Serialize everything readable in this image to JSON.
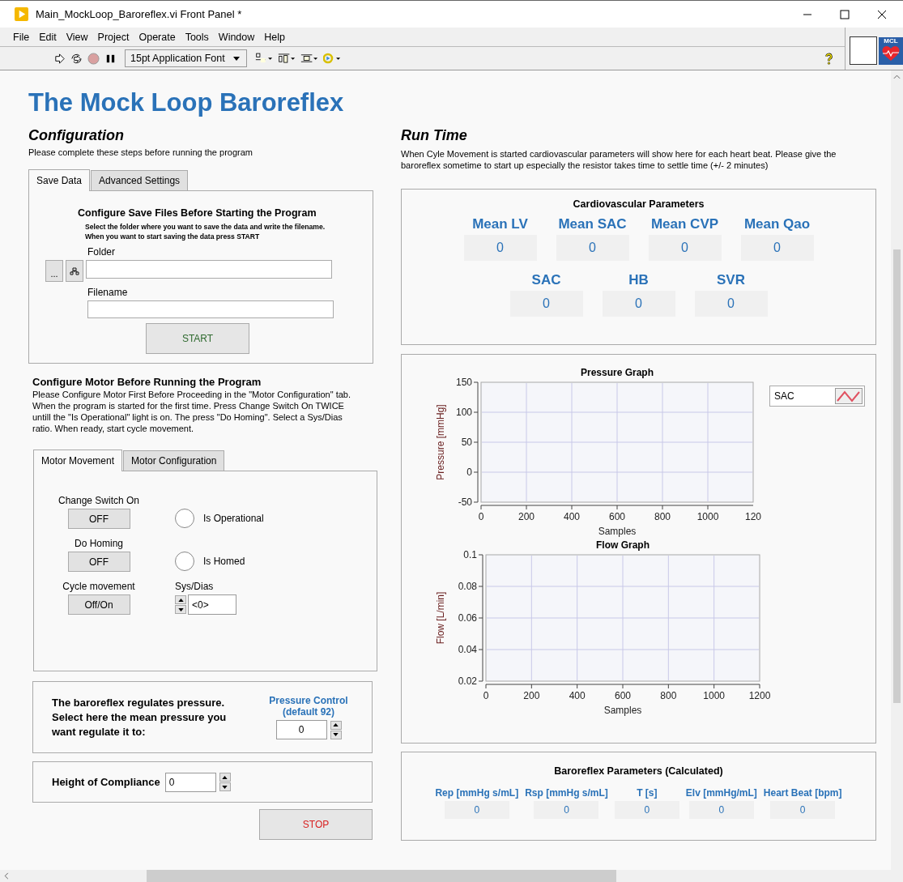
{
  "window": {
    "title": "Main_MockLoop_Baroreflex.vi Front Panel *"
  },
  "menu": [
    "File",
    "Edit",
    "View",
    "Project",
    "Operate",
    "Tools",
    "Window",
    "Help"
  ],
  "toolbar": {
    "font_select": "15pt Application Font",
    "logo_text": "MCL"
  },
  "page_title": "The Mock Loop Baroreflex",
  "configuration": {
    "heading": "Configuration",
    "subtitle": "Please complete these steps before running the program",
    "tabs": [
      {
        "label": "Save Data",
        "selected": true
      },
      {
        "label": "Advanced Settings",
        "selected": false
      }
    ],
    "save_panel": {
      "heading": "Configure Save Files Before Starting the Program",
      "instructions": "Select the folder where you want to save the data and write the filename. When you want to start saving the data press START",
      "browse_button": "...",
      "folder_label": "Folder",
      "filename_label": "Filename",
      "start_button": "START"
    },
    "motor": {
      "heading": "Configure Motor Before Running the Program",
      "instructions": "Please Configure Motor First Before Proceeding in the \"Motor Configuration\" tab. When the program is started for the first time. Press Change Switch On TWICE untill the \"Is Operational\" light is on. The press \"Do Homing\". Select a Sys/Dias ratio. When ready, start cycle movement.",
      "tabs": [
        {
          "label": "Motor Movement",
          "selected": true
        },
        {
          "label": "Motor Configuration",
          "selected": false
        }
      ],
      "controls": [
        {
          "label": "Change Switch On",
          "button": "OFF",
          "indicator": {
            "label": "Is Operational",
            "on": false
          }
        },
        {
          "label": "Do Homing",
          "button": "OFF",
          "indicator": {
            "label": "Is Homed",
            "on": false
          }
        },
        {
          "label": "Cycle movement",
          "button": "Off/On",
          "sys_dias": {
            "label": "Sys/Dias",
            "value": "<0>"
          }
        }
      ]
    },
    "pressure_control": {
      "text": "The baroreflex regulates pressure. Select here the mean pressure you want regulate it to:",
      "label": "Pressure Control (default 92)",
      "value": "0"
    },
    "compliance": {
      "label": "Height of Compliance",
      "value": "0"
    },
    "stop_button": "STOP"
  },
  "run_time": {
    "heading": "Run Time",
    "description": "When Cyle Movement is started cardiovascular parameters will show here for each heart beat. Please give the baroreflex sometime to start up especially the resistor takes time to settle time (+/- 2 minutes)",
    "cardiovascular": {
      "title": "Cardiovascular Parameters",
      "rows": [
        [
          {
            "label": "Mean LV",
            "value": "0"
          },
          {
            "label": "Mean SAC",
            "value": "0"
          },
          {
            "label": "Mean CVP",
            "value": "0"
          },
          {
            "label": "Mean Qao",
            "value": "0"
          }
        ],
        [
          {
            "label": "SAC",
            "value": "0"
          },
          {
            "label": "HB",
            "value": "0"
          },
          {
            "label": "SVR",
            "value": "0"
          }
        ]
      ]
    },
    "pressure_graph": {
      "chart_data": {
        "type": "line",
        "title": "Pressure Graph",
        "xlabel": "Samples",
        "ylabel": "Pressure [mmHg]",
        "xlim": [
          0,
          1200
        ],
        "ylim": [
          -50,
          150
        ],
        "xticks": [
          0,
          200,
          400,
          600,
          800,
          1000
        ],
        "yticks": [
          -50,
          0,
          50,
          100,
          150
        ],
        "grid": true
      },
      "x_edge_label": "120",
      "legend": [
        {
          "name": "SAC",
          "color": "#e05060"
        }
      ]
    },
    "flow_graph": {
      "chart_data": {
        "type": "line",
        "title": "Flow Graph",
        "xlabel": "Samples",
        "ylabel": "Flow [L/min]",
        "xlim": [
          0,
          1200
        ],
        "ylim": [
          0.02,
          0.1
        ],
        "xticks": [
          0,
          200,
          400,
          600,
          800,
          1000,
          1200
        ],
        "yticks": [
          0.02,
          0.04,
          0.06,
          0.08,
          0.1
        ],
        "grid": true
      }
    },
    "baroreflex": {
      "title": "Baroreflex Parameters (Calculated)",
      "params": [
        {
          "label": "Rep [mmHg s/mL]",
          "value": "0"
        },
        {
          "label": "Rsp  [mmHg s/mL]",
          "value": "0"
        },
        {
          "label": "T [s]",
          "value": "0"
        },
        {
          "label": "Elv [mmHg/mL]",
          "value": "0"
        },
        {
          "label": "Heart Beat [bpm]",
          "value": "0"
        }
      ]
    }
  }
}
